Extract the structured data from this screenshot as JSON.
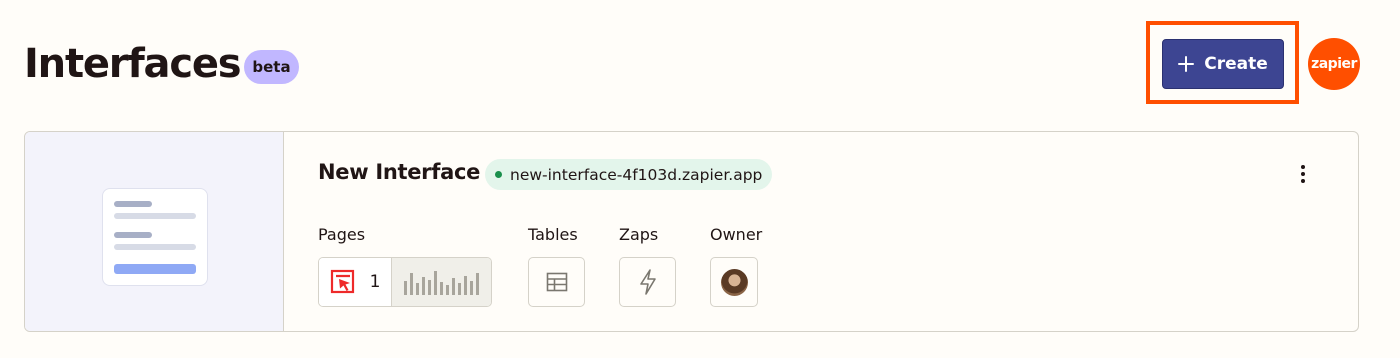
{
  "header": {
    "title": "Interfaces",
    "badge": "beta",
    "create_label": "Create",
    "brand_logo_text": "zapier"
  },
  "colors": {
    "accent": "#3d4592",
    "brand": "#ff4f00",
    "badge_bg": "#c1b7ff",
    "url_pill_bg": "#e3f5eb",
    "status_dot": "#1a8f4c"
  },
  "interface": {
    "name": "New Interface",
    "url": "new-interface-4f103d.zapier.app",
    "labels": {
      "pages": "Pages",
      "tables": "Tables",
      "zaps": "Zaps",
      "owner": "Owner"
    },
    "pages_count": "1",
    "icons": {
      "pages": "cursor-page-icon",
      "tables": "table-icon",
      "zaps": "lightning-bolt-icon",
      "owner": "avatar",
      "more": "more-vertical-icon",
      "create": "plus-icon"
    }
  }
}
